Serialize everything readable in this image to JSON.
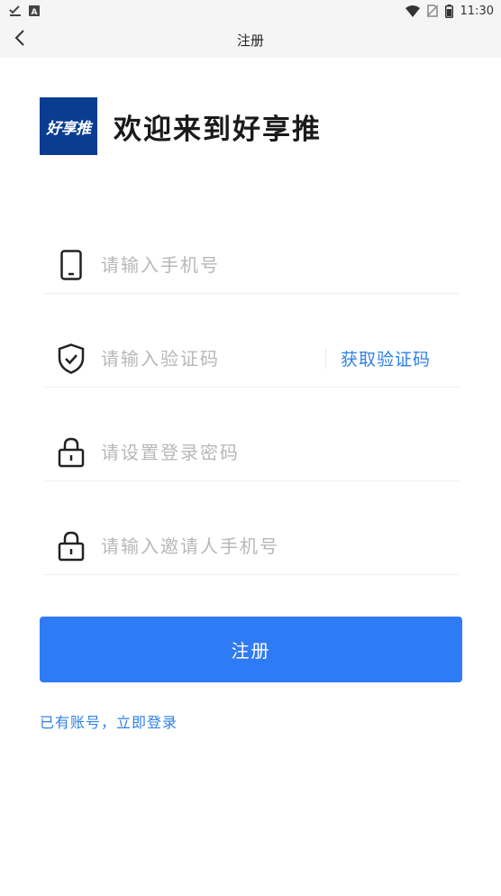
{
  "status_bar": {
    "time": "11:30",
    "icons": [
      "check-download-icon",
      "notification-a-icon",
      "wifi-icon",
      "no-sim-icon",
      "battery-icon"
    ]
  },
  "nav": {
    "back_icon": "chevron-left-icon",
    "title": "注册"
  },
  "header": {
    "logo_text": "好享推",
    "welcome": "欢迎来到好享推"
  },
  "form": {
    "phone": {
      "icon": "phone-icon",
      "placeholder": "请输入手机号"
    },
    "code": {
      "icon": "shield-check-icon",
      "placeholder": "请输入验证码",
      "get_code_label": "获取验证码"
    },
    "password": {
      "icon": "lock-icon",
      "placeholder": "请设置登录密码"
    },
    "inviter": {
      "icon": "lock-icon",
      "placeholder": "请输入邀请人手机号"
    }
  },
  "actions": {
    "register_label": "注册",
    "login_link": "已有账号，立即登录"
  },
  "colors": {
    "accent": "#2f7bf5",
    "link": "#2f80e8",
    "logo_bg": "#0a3d91"
  }
}
